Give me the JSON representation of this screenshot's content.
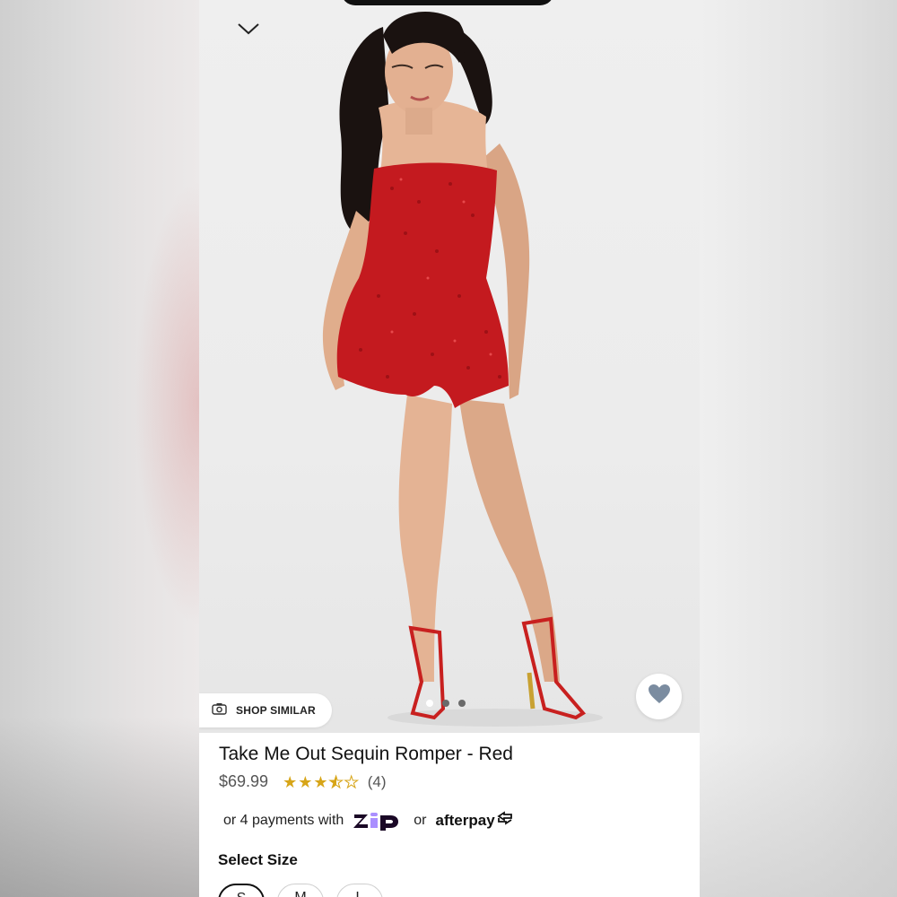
{
  "product": {
    "title": "Take Me Out Sequin Romper - Red",
    "price": "$69.99",
    "rating": 3.5,
    "rating_max": 5,
    "review_count": "(4)",
    "color_accent": "#d7a518"
  },
  "gallery": {
    "shop_similar_label": "SHOP SIMILAR",
    "image_count": 3,
    "active_index": 0
  },
  "payment": {
    "prefix": "or 4 payments with",
    "zip_label": "zip",
    "or": "or",
    "afterpay_label": "afterpay"
  },
  "sizes": {
    "label": "Select Size",
    "options": [
      "S",
      "M",
      "L"
    ],
    "selected": "S"
  }
}
